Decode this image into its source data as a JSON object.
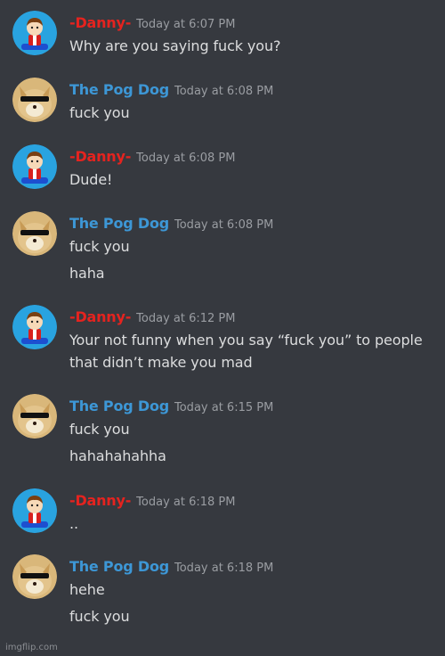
{
  "users": {
    "danny": {
      "name": "-Danny-",
      "color": "#e5231f"
    },
    "pog": {
      "name": "The Pog Dog",
      "color": "#3d97d6"
    }
  },
  "messages": [
    {
      "author": "-Danny-",
      "time": "Today at 6:07 PM",
      "lines": [
        "Why are you saying fuck you?"
      ]
    },
    {
      "author": "The Pog Dog",
      "time": "Today at 6:08 PM",
      "lines": [
        "fuck you"
      ]
    },
    {
      "author": "-Danny-",
      "time": "Today at 6:08 PM",
      "lines": [
        "Dude!"
      ]
    },
    {
      "author": "The Pog Dog",
      "time": "Today at 6:08 PM",
      "lines": [
        "fuck you",
        "haha"
      ]
    },
    {
      "author": "-Danny-",
      "time": "Today at 6:12 PM",
      "lines": [
        "Your not funny when you say “fuck you” to people",
        "that didn’t make you mad"
      ]
    },
    {
      "author": "The Pog Dog",
      "time": "Today at 6:15 PM",
      "lines": [
        "fuck you",
        "hahahahahha"
      ]
    },
    {
      "author": "-Danny-",
      "time": "Today at 6:18 PM",
      "lines": [
        ".."
      ]
    },
    {
      "author": "The Pog Dog",
      "time": "Today at 6:18 PM",
      "lines": [
        "hehe",
        "fuck you"
      ]
    }
  ],
  "watermark": "imgflip.com",
  "icons": {
    "danny_avatar": "cartoon-boy-avatar-icon",
    "pog_avatar": "doge-sunglasses-avatar-icon"
  }
}
